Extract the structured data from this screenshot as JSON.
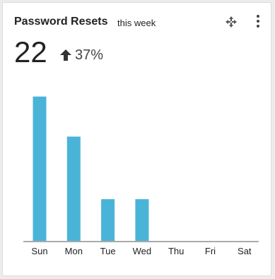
{
  "widget": {
    "title": "Password Resets",
    "subtitle": "this week",
    "value": "22",
    "change": "37%",
    "change_direction": "up",
    "icons": [
      "move-icon",
      "more-vert-icon",
      "arrow-up-icon"
    ]
  },
  "colors": {
    "bar": "#4ab4d8",
    "text": "#222222",
    "axis": "#555555"
  },
  "chart_data": {
    "type": "bar",
    "categories": [
      "Sun",
      "Mon",
      "Tue",
      "Wed",
      "Thu",
      "Fri",
      "Sat"
    ],
    "values": [
      9,
      6.5,
      2.6,
      2.6,
      0,
      0,
      0
    ],
    "title": "",
    "xlabel": "",
    "ylabel": "",
    "ylim": [
      0,
      10
    ],
    "grid": false,
    "legend": "none"
  }
}
